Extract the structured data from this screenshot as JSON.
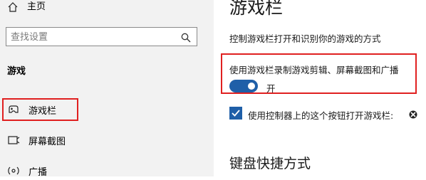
{
  "sidebar": {
    "home_label": "主页",
    "search_placeholder": "查找设置",
    "section_heading": "游戏",
    "items": [
      {
        "label": "游戏栏",
        "icon": "game-bar-icon"
      },
      {
        "label": "屏幕截图",
        "icon": "capture-icon"
      },
      {
        "label": "广播",
        "icon": "broadcast-icon"
      }
    ]
  },
  "main": {
    "title": "游戏栏",
    "subtitle": "控制游戏栏打开和识别你的游戏的方式",
    "toggle": {
      "description": "使用游戏栏录制游戏剪辑、屏幕截图和广播",
      "state_label": "开",
      "on": true
    },
    "checkbox": {
      "label": "使用控制器上的这个按钮打开游戏栏:",
      "checked": true
    },
    "section2_title": "键盘快捷方式"
  },
  "colors": {
    "accent": "#1f5fa8",
    "highlight": "#e02020",
    "sidebar_bg": "#f2f2f2"
  }
}
